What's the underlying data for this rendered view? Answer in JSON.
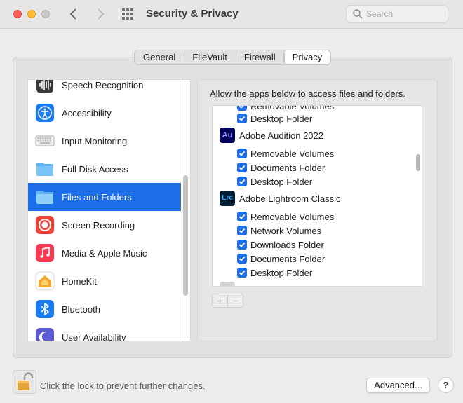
{
  "window": {
    "title": "Security & Privacy"
  },
  "search": {
    "placeholder": "Search"
  },
  "tabs": [
    {
      "label": "General"
    },
    {
      "label": "FileVault"
    },
    {
      "label": "Firewall"
    },
    {
      "label": "Privacy",
      "active": true
    }
  ],
  "sidebar": {
    "items": [
      {
        "label": "Speech Recognition",
        "icon": "speech-waveform-icon"
      },
      {
        "label": "Accessibility",
        "icon": "accessibility-icon"
      },
      {
        "label": "Input Monitoring",
        "icon": "keyboard-icon"
      },
      {
        "label": "Full Disk Access",
        "icon": "folder-icon"
      },
      {
        "label": "Files and Folders",
        "icon": "folder-icon",
        "selected": true
      },
      {
        "label": "Screen Recording",
        "icon": "record-icon"
      },
      {
        "label": "Media & Apple Music",
        "icon": "music-note-icon"
      },
      {
        "label": "HomeKit",
        "icon": "home-icon"
      },
      {
        "label": "Bluetooth",
        "icon": "bluetooth-icon"
      },
      {
        "label": "User Availability",
        "icon": "moon-icon"
      }
    ]
  },
  "main": {
    "description": "Allow the apps below to access files and folders.",
    "partial_top": "Removable Volumes",
    "rows": [
      {
        "type": "perm",
        "label": "Desktop Folder",
        "checked": true
      },
      {
        "type": "app",
        "name": "Adobe Audition 2022",
        "icon_text": "Au",
        "icon_color": "#00005b",
        "icon_text_color": "#9999ff"
      },
      {
        "type": "perm",
        "label": "Removable Volumes",
        "checked": true
      },
      {
        "type": "perm",
        "label": "Documents Folder",
        "checked": true
      },
      {
        "type": "perm",
        "label": "Desktop Folder",
        "checked": true
      },
      {
        "type": "app",
        "name": "Adobe Lightroom Classic",
        "icon_text": "Lrc",
        "icon_color": "#001e36",
        "icon_text_color": "#31a8ff"
      },
      {
        "type": "perm",
        "label": "Removable Volumes",
        "checked": true
      },
      {
        "type": "perm",
        "label": "Network Volumes",
        "checked": true
      },
      {
        "type": "perm",
        "label": "Downloads Folder",
        "checked": true
      },
      {
        "type": "perm",
        "label": "Documents Folder",
        "checked": true
      },
      {
        "type": "perm",
        "label": "Desktop Folder",
        "checked": true
      }
    ],
    "add_label": "+",
    "remove_label": "−"
  },
  "footer": {
    "lock_text": "Click the lock to prevent further changes.",
    "advanced_label": "Advanced...",
    "help_label": "?"
  },
  "colors": {
    "accent": "#1b6ee7",
    "traffic_close": "#fe5f57",
    "traffic_min": "#febc2e"
  }
}
